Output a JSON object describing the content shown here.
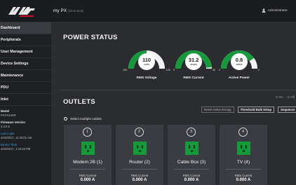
{
  "header": {
    "title": "my PX",
    "version": "(10.0.42.5)",
    "user": "Administrator"
  },
  "sidebar": {
    "items": [
      {
        "label": "Dashboard",
        "active": true
      },
      {
        "label": "Peripherals"
      },
      {
        "label": "User Management"
      },
      {
        "label": "Device Settings"
      },
      {
        "label": "Maintenance"
      },
      {
        "label": "PDU"
      },
      {
        "label": "Inlet"
      }
    ],
    "info": {
      "model_label": "Model",
      "model_value": "PX3-5145R",
      "firmware_label": "Firmware Version",
      "firmware_value": "3.3.0.5",
      "last_login_label": "Last Login",
      "last_login_value": "4/24/2017, 11:28:01 AM",
      "device_time_label": "Device Time",
      "device_time_value": "4/24/2017, 1:23:43 PM"
    }
  },
  "power_status": {
    "title": "POWER STATUS",
    "gauges": [
      {
        "value": "110",
        "unit": "volts",
        "min": "100",
        "max": "120",
        "label": "RMS Voltage",
        "fill_fraction": 0.5
      },
      {
        "value": "31.2",
        "unit": "amps",
        "min": "0",
        "max": "32",
        "label": "RMS Current",
        "fill_fraction": 0.975
      },
      {
        "value": "0.8",
        "unit": "watts",
        "min": "0",
        "max": "1",
        "label": "Active Power",
        "fill_fraction": 0.8
      }
    ]
  },
  "outlets": {
    "title": "OUTLETS",
    "toggle_on": "On",
    "toggle_off": "Off",
    "buttons": [
      "Reset Active Energy",
      "Threshold Bulk Setup",
      "Sequence"
    ],
    "select_multiple": "Select multiple outlets.",
    "items": [
      {
        "num": "1",
        "name": "Modem 2B (1)",
        "current_label": "RMS Current",
        "current": "0.000 A"
      },
      {
        "num": "2",
        "name": "Router (2)",
        "current_label": "RMS Current",
        "current": "0.000 A"
      },
      {
        "num": "3",
        "name": "Cable Box (3)",
        "current_label": "RMS Current",
        "current": "0.000 A"
      },
      {
        "num": "4",
        "name": "TV (4)",
        "current_label": "RMS Current",
        "current": "0.000 A"
      }
    ]
  },
  "colors": {
    "accent_green": "#149a3a",
    "link_blue": "#3a9ad9",
    "logo_red": "#c8102e"
  }
}
